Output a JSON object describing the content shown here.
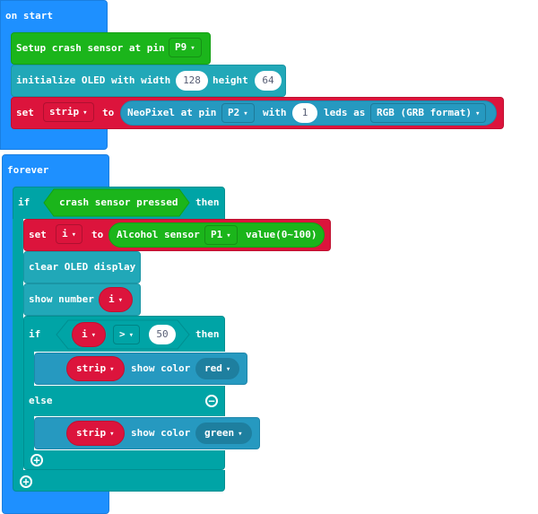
{
  "on_start": {
    "label": "on start",
    "setup_crash": {
      "text": "Setup crash sensor at pin",
      "pin": "P9"
    },
    "init_oled": {
      "text": "initialize OLED with width",
      "width": "128",
      "height_label": "height",
      "height": "64"
    },
    "set_strip": {
      "set": "set",
      "var": "strip",
      "to": "to",
      "neo_text": "NeoPixel at pin",
      "pin": "P2",
      "with": "with",
      "leds": "1",
      "leds_as": "leds as",
      "format": "RGB (GRB format)"
    }
  },
  "forever": {
    "label": "forever",
    "if1": {
      "if": "if",
      "cond": "crash sensor pressed",
      "then": "then"
    },
    "set_i": {
      "set": "set",
      "var": "i",
      "to": "to",
      "sensor_text": "Alcohol sensor",
      "pin": "P1",
      "value_text": "value(0~100)"
    },
    "clear": "clear OLED display",
    "show_number": {
      "text": "show number",
      "var": "i"
    },
    "if2": {
      "if": "if",
      "var": "i",
      "op": ">",
      "value": "50",
      "then": "then",
      "else": "else"
    },
    "then_strip": {
      "var": "strip",
      "text": "show color",
      "color": "red"
    },
    "else_strip": {
      "var": "strip",
      "text": "show color",
      "color": "green"
    }
  },
  "caret": "▾",
  "icons": {
    "minus": "−",
    "plus": "+"
  }
}
